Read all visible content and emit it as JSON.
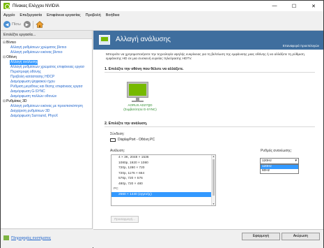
{
  "window": {
    "title": "Πίνακας Ελέγχου NVIDIA",
    "controls": [
      "—",
      "☐",
      "✕"
    ]
  },
  "menu": [
    "Αρχείο",
    "Επεξεργασία",
    "Επιφάνεια εργασίας",
    "Προβολή",
    "Βοήθεια"
  ],
  "toolbar": {
    "back_label": "Πίσω"
  },
  "sidebar": {
    "header": "Επιλέξτε εργασία...",
    "tree": [
      {
        "type": "cat",
        "label": "Βίντεο",
        "expander": "⊟"
      },
      {
        "type": "item",
        "label": "Αλλαγή ρυθμίσεων χρώματος βίντεο"
      },
      {
        "type": "item",
        "label": "Αλλαγή ρυθμίσεων εικόνας βίντεο"
      },
      {
        "type": "cat",
        "label": "Οθόνη",
        "expander": "⊟"
      },
      {
        "type": "item",
        "label": "Αλλαγή ανάλυσης",
        "selected": true
      },
      {
        "type": "item",
        "label": "Αλλαγή ρυθμίσεων χρώματος επιφάνειας εργασ"
      },
      {
        "type": "item",
        "label": "Περιστροφή οθόνης"
      },
      {
        "type": "item",
        "label": "Προβολή κατάστασης HDCP"
      },
      {
        "type": "item",
        "label": "Διαμόρφωση ψηφιακού ήχου"
      },
      {
        "type": "item",
        "label": "Ρύθμιση μεγέθους και θέσης επιφάνειας εργασ"
      },
      {
        "type": "item",
        "label": "Διαμόρφωση G-SYNC"
      },
      {
        "type": "item",
        "label": "Διαμόρφωση πολλών οθονών"
      },
      {
        "type": "cat",
        "label": "Ρυθμίσεις 3D",
        "expander": "⊟"
      },
      {
        "type": "item",
        "label": "Αλλαγή ρυθμίσεων εικόνας με προεπισκόπηση"
      },
      {
        "type": "item",
        "label": "Διαχείριση ρυθμίσεων 3D"
      },
      {
        "type": "item",
        "label": "Διαμόρφωση Surround, PhysX"
      }
    ],
    "footer_link": "Πληροφορίες συστήματος"
  },
  "content": {
    "title": "Αλλαγή ανάλυσης",
    "restore_link": "Επαναφορά προεπιλογών",
    "description": "Μπορείτε να χρησιμοποιήσετε την τεχνολογία υψηλής ευκρίνειας για τη βελτίωση της εμφάνισης μιας οθόνης ή να αλλάξετε τη ρύθμιση εμφάνισης HD σε μια συσκευή ευρείας τηλεόρασης HDTV.",
    "step1": "1. Επιλέξτε την οθόνη που θέλετε να αλλάξετε.",
    "monitor_label": "AORUS AD27QD\n(Συμβατότητα G-SYNC)",
    "step2": "2. Επιλέξτε την ανάλυση.",
    "connection_label": "Σύνδεση:",
    "connection_value": "DisplayPort - Οθόνη PC",
    "resolution_label": "Ανάλυση:",
    "resolutions": [
      {
        "label": "4 × 3K, 2048 × 1536",
        "group": false
      },
      {
        "label": "1080p, 1920 × 1080",
        "group": false
      },
      {
        "label": "720p, 1280 × 720",
        "group": false
      },
      {
        "label": "720p, 1176 × 664",
        "group": false
      },
      {
        "label": "576p, 720 × 576",
        "group": false
      },
      {
        "label": "480p, 720 × 480",
        "group": false
      },
      {
        "label": "PC",
        "group": true
      },
      {
        "label": "2560 × 1440 (εγγενής)",
        "group": false,
        "selected": true
      }
    ],
    "refresh_label": "Ρυθμός ανανέωσης:",
    "refresh_selected": "120Hz",
    "refresh_options": [
      {
        "label": "120Hz",
        "selected": true
      },
      {
        "label": "60Hz",
        "selected": false
      }
    ],
    "customize_button": "Προσαρμογή..."
  },
  "buttons": {
    "apply": "Εφαρμογή",
    "cancel": "Ακύρωση"
  },
  "colors": {
    "accent": "#76b900",
    "banner": "#3f6e9e",
    "selection": "#3399ff",
    "link": "#2266cc"
  }
}
